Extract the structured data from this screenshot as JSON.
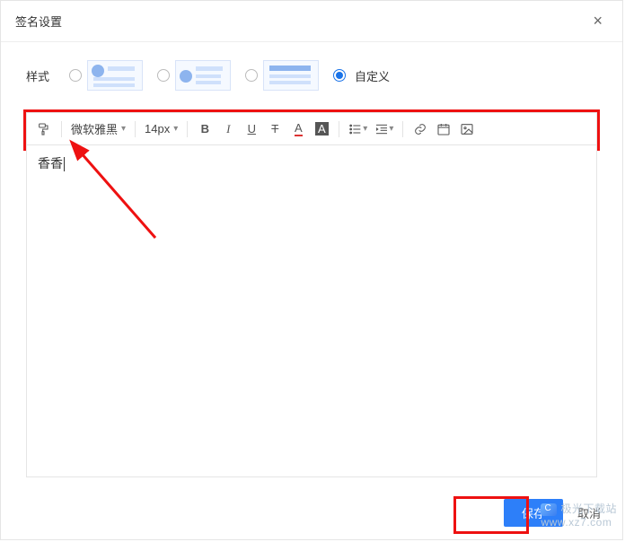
{
  "dialog": {
    "title": "签名设置",
    "close_aria": "关闭"
  },
  "style_row": {
    "label": "样式",
    "custom_label": "自定义"
  },
  "toolbar": {
    "font_family": "微软雅黑",
    "font_size": "14px",
    "icons": {
      "format_painter": "format-painter-icon",
      "bold": "B",
      "italic": "I",
      "underline": "U",
      "strike": "T",
      "font_color": "A",
      "bg_color": "A"
    }
  },
  "editor": {
    "content": "香香"
  },
  "footer": {
    "save": "保存",
    "cancel": "取消"
  },
  "watermark": {
    "brand": "极光下载站",
    "url": "www.xz7.com"
  }
}
